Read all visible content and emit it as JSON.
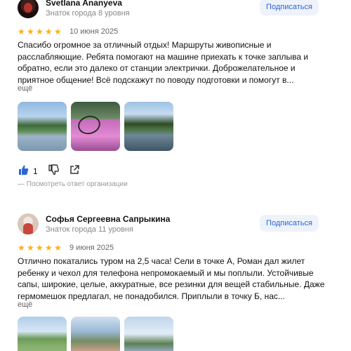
{
  "reviews": [
    {
      "author": "Svetlana Ananyeva",
      "level": "Знаток города 8 уровня",
      "subscribe_label": "Подписаться",
      "rating": 5,
      "stars": [
        "★",
        "★",
        "★",
        "★",
        "★"
      ],
      "date": "10 июня 2025",
      "text": "Спасибо огромное за отличный отдых! Маршруты живописные и расслабляющие. Ребята помогают на машине приехать к точке заплыва и обратно, если это далеко от станции электрички. Доброжелательное и приятное общение! Всё подскажут по поводу подготовки и помогут в...",
      "more_label": "ещё",
      "photos": [
        "river-photo",
        "sup-board-photo",
        "river-sunset-photo"
      ],
      "likes": "1",
      "reply_label": "— Посмотреть ответ организации"
    },
    {
      "author": "Софья Сергеевна Сапрыкина",
      "level": "Знаток города 11 уровня",
      "subscribe_label": "Подписаться",
      "rating": 5,
      "stars": [
        "★",
        "★",
        "★",
        "★",
        "★"
      ],
      "date": "9 июня 2025",
      "text": "Отлично покатались туром на 2,5 часа! Сели в точке А, Роман дал жилет ребенку и чехол для телефона непромокаемый и мы поплыли. Устойчивые сапы, широкие, целые, аккуратные, все резинки для вещей стабильные. Даже гермомешок предлагал, не понадобился. Приплыли в точку Б, нас...",
      "more_label": "ещё",
      "photos": [
        "meadow-photo",
        "people-on-sup-photo",
        "river-bank-photo"
      ]
    }
  ],
  "colors": {
    "star": "#fcb20f",
    "accent": "#2d66d4",
    "button_bg": "#eef2fb",
    "secondary_text": "#888888"
  },
  "icons": [
    "thumbs-up-icon",
    "thumbs-down-icon",
    "share-icon"
  ]
}
